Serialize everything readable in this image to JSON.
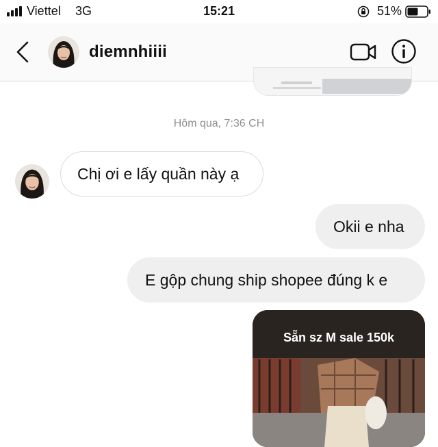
{
  "status_bar": {
    "carrier": "Viettel",
    "network": "3G",
    "time": "15:21",
    "battery": "51%"
  },
  "header": {
    "username": "diemnhiiii",
    "icons": [
      "back-icon",
      "avatar",
      "video-call-icon",
      "info-icon"
    ]
  },
  "conversation": {
    "timestamp": "Hôm qua, 7:36 CH",
    "messages": [
      {
        "direction": "incoming",
        "text": "Chị ơi e lấy quần này ạ"
      },
      {
        "direction": "outgoing",
        "text": "Okii e nha"
      },
      {
        "direction": "outgoing",
        "text": "E gộp chung ship shopee đúng k e"
      },
      {
        "direction": "outgoing",
        "type": "image",
        "caption": "Sẵn sz M sale 150k"
      }
    ]
  },
  "colors": {
    "outgoing_bubble": "#efefef",
    "incoming_border": "#dbdbdb",
    "timestamp": "#8e8e8e",
    "header_bg": "#fafafa"
  }
}
